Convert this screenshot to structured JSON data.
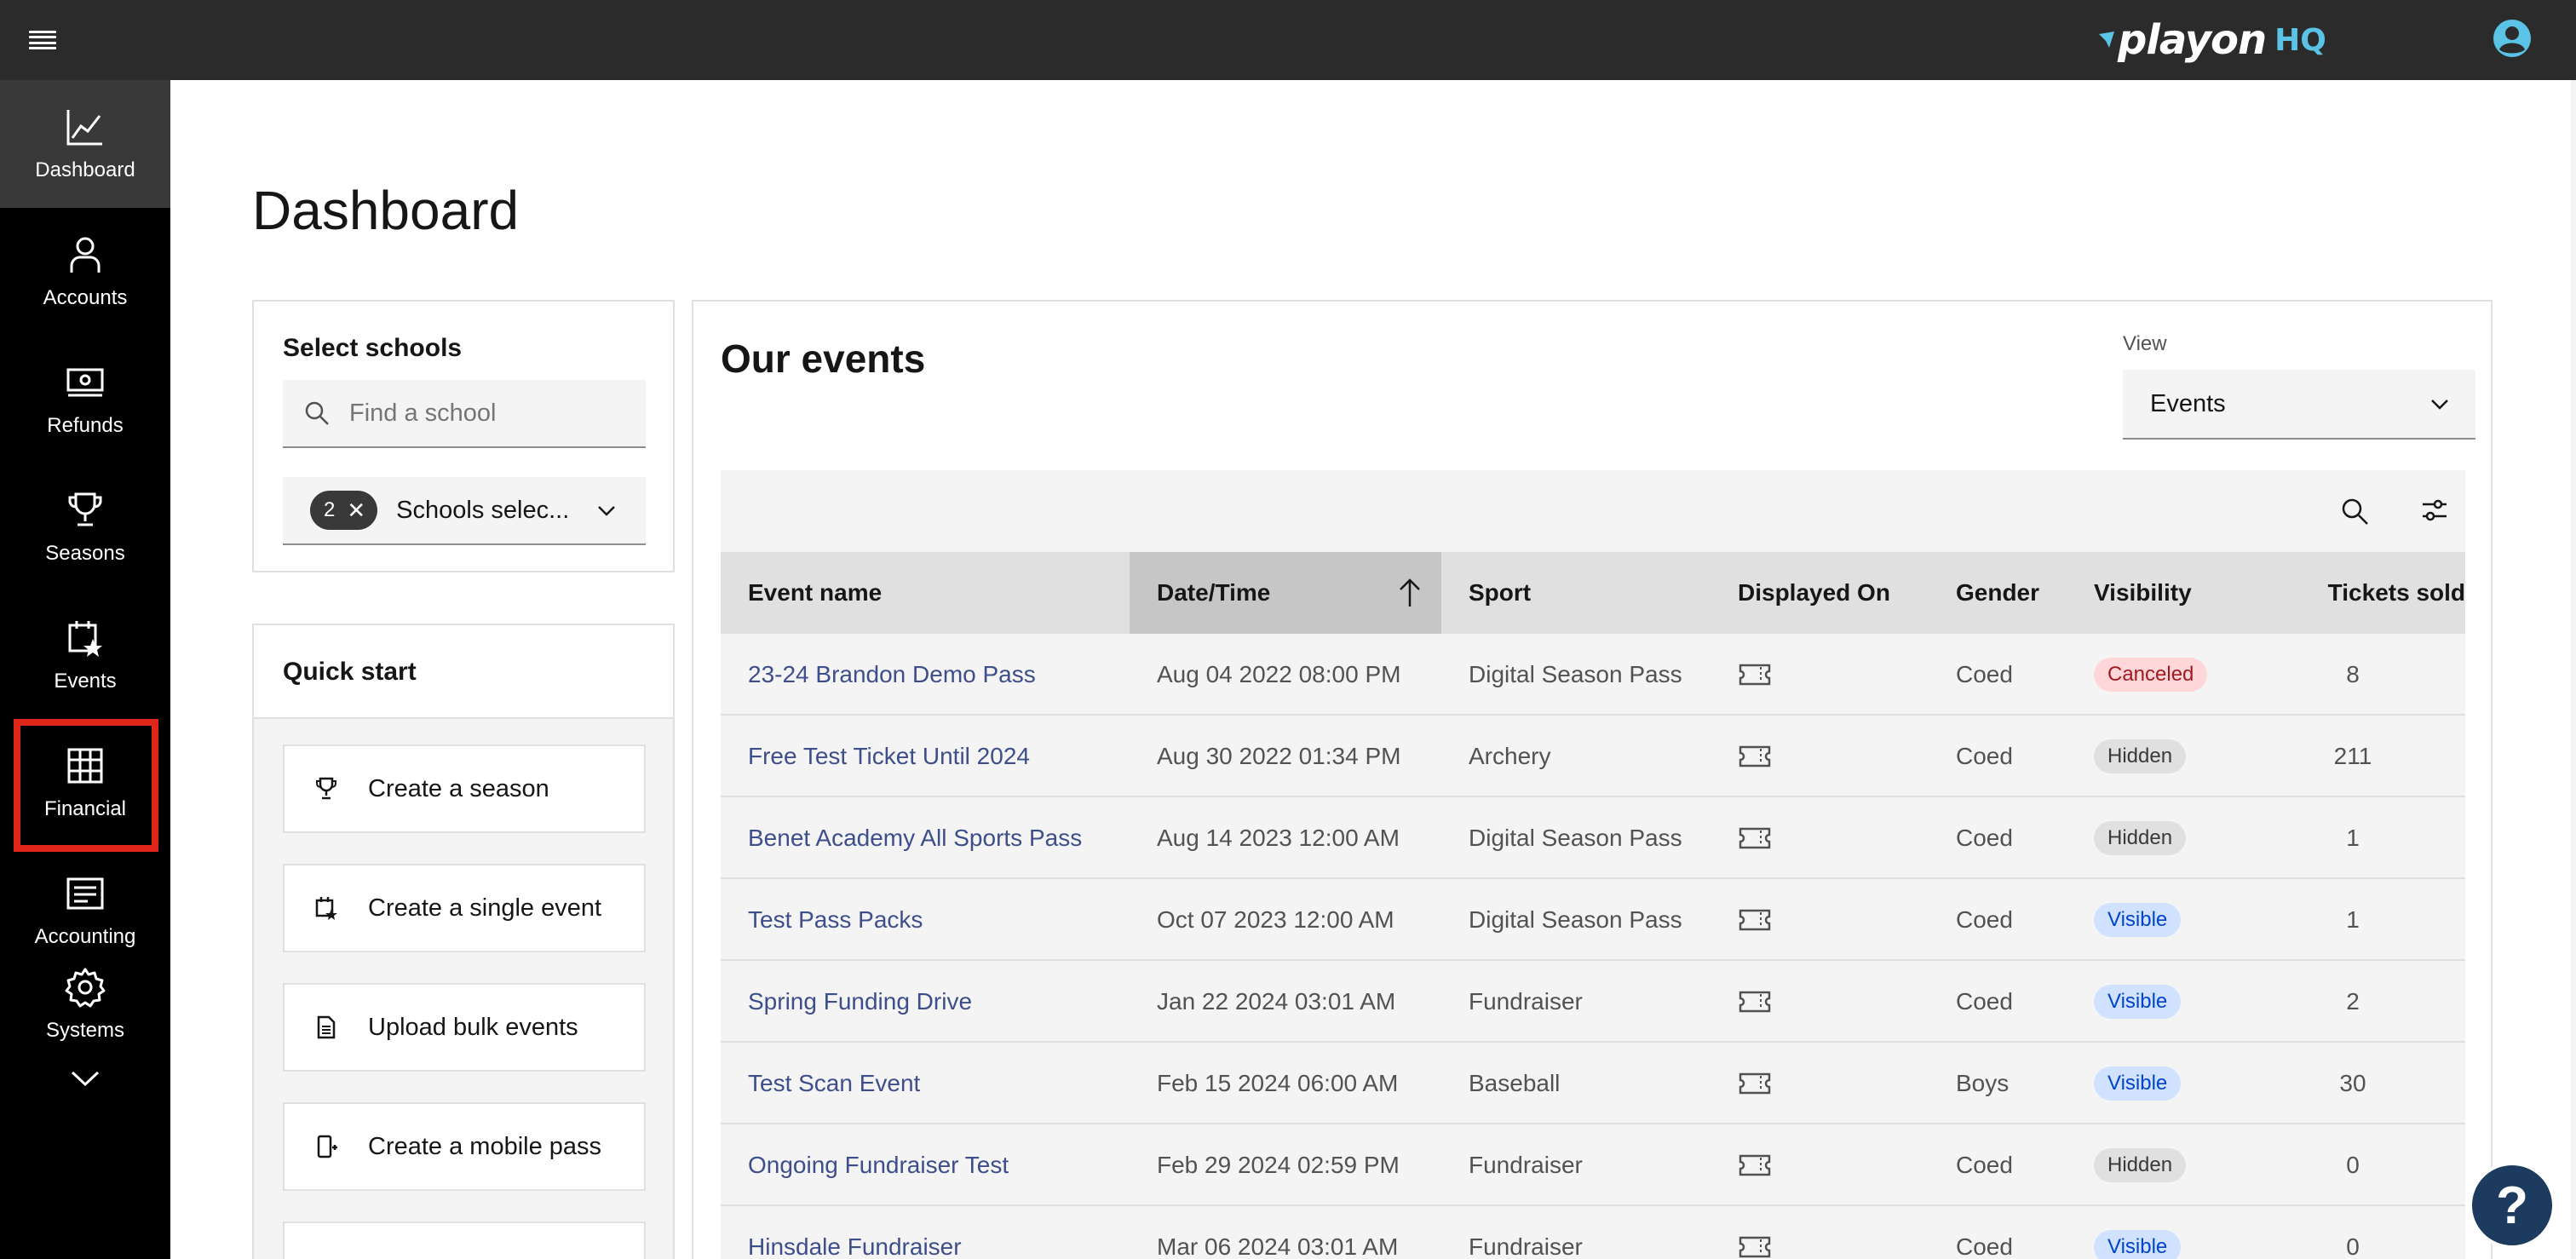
{
  "header": {
    "logo_text": "playon",
    "logo_suffix": "HQ",
    "menu_icon": "hamburger-icon",
    "user_icon": "user-avatar-icon"
  },
  "sidebar": {
    "items": [
      {
        "label": "Dashboard",
        "icon": "chart-line-icon",
        "active": true
      },
      {
        "label": "Accounts",
        "icon": "user-icon"
      },
      {
        "label": "Refunds",
        "icon": "cash-icon"
      },
      {
        "label": "Seasons",
        "icon": "trophy-icon"
      },
      {
        "label": "Events",
        "icon": "calendar-star-icon"
      },
      {
        "label": "Financial",
        "icon": "table-grid-icon",
        "highlighted": true
      },
      {
        "label": "Accounting",
        "icon": "ledger-icon"
      },
      {
        "label": "Systems",
        "icon": "gear-icon"
      }
    ],
    "expand_icon": "chevron-down-icon"
  },
  "page": {
    "title": "Dashboard"
  },
  "schools": {
    "heading": "Select schools",
    "search_placeholder": "Find a school",
    "selected_count": "2",
    "selected_label": "Schools selec..."
  },
  "quick_start": {
    "heading": "Quick start",
    "buttons": [
      {
        "label": "Create a season",
        "icon": "trophy-icon"
      },
      {
        "label": "Create a single event",
        "icon": "calendar-star-icon"
      },
      {
        "label": "Upload bulk events",
        "icon": "document-icon"
      },
      {
        "label": "Create a mobile pass",
        "icon": "mobile-add-icon"
      }
    ]
  },
  "events": {
    "heading": "Our events",
    "view_label": "View",
    "view_value": "Events",
    "columns": [
      "Event name",
      "Date/Time",
      "Sport",
      "Displayed On",
      "Gender",
      "Visibility",
      "Tickets sold"
    ],
    "rows": [
      {
        "name": "23-24 Brandon Demo Pass",
        "date": "Aug 04 2022 08:00 PM",
        "sport": "Digital Season Pass",
        "gender": "Coed",
        "visibility": "Canceled",
        "tickets": "8"
      },
      {
        "name": "Free Test Ticket Until 2024",
        "date": "Aug 30 2022 01:34 PM",
        "sport": "Archery",
        "gender": "Coed",
        "visibility": "Hidden",
        "tickets": "211"
      },
      {
        "name": "Benet Academy All Sports Pass",
        "date": "Aug 14 2023 12:00 AM",
        "sport": "Digital Season Pass",
        "gender": "Coed",
        "visibility": "Hidden",
        "tickets": "1"
      },
      {
        "name": "Test Pass Packs",
        "date": "Oct 07 2023 12:00 AM",
        "sport": "Digital Season Pass",
        "gender": "Coed",
        "visibility": "Visible",
        "tickets": "1"
      },
      {
        "name": "Spring Funding Drive",
        "date": "Jan 22 2024 03:01 AM",
        "sport": "Fundraiser",
        "gender": "Coed",
        "visibility": "Visible",
        "tickets": "2"
      },
      {
        "name": "Test Scan Event",
        "date": "Feb 15 2024 06:00 AM",
        "sport": "Baseball",
        "gender": "Boys",
        "visibility": "Visible",
        "tickets": "30"
      },
      {
        "name": "Ongoing Fundraiser Test",
        "date": "Feb 29 2024 02:59 PM",
        "sport": "Fundraiser",
        "gender": "Coed",
        "visibility": "Hidden",
        "tickets": "0"
      },
      {
        "name": "Hinsdale Fundraiser",
        "date": "Mar 06 2024 03:01 AM",
        "sport": "Fundraiser",
        "gender": "Coed",
        "visibility": "Visible",
        "tickets": "0"
      }
    ]
  },
  "help": {
    "label": "?"
  },
  "colors": {
    "header_bg": "#2b2b2b",
    "sidebar_bg": "#000000",
    "highlight": "#e0261a",
    "link": "#3d4e8a",
    "logo_accent": "#5bc4e6"
  }
}
